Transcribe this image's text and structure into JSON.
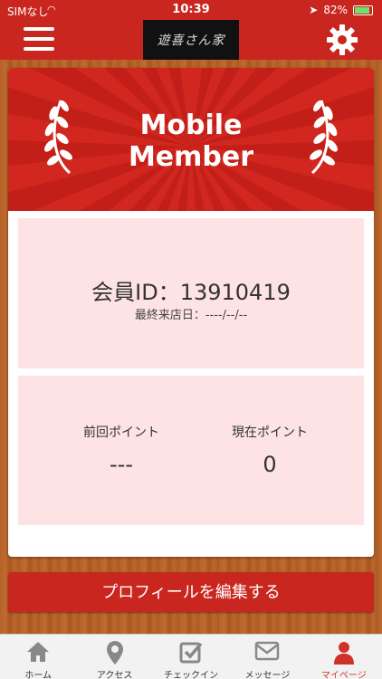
{
  "status_bar": {
    "carrier": "SIMなし",
    "time": "10:39",
    "battery": "82%"
  },
  "header": {
    "logo_text": "遊喜さん家"
  },
  "banner": {
    "title": "Mobile\nMember"
  },
  "member": {
    "id_label": "会員ID：13910419",
    "last_visit": "最終来店日：----/--/--"
  },
  "points": {
    "previous_label": "前回ポイント",
    "previous_value": "---",
    "current_label": "現在ポイント",
    "current_value": "0"
  },
  "edit_profile_label": "プロフィールを編集する",
  "tabs": [
    {
      "label": "ホーム",
      "icon": "home-icon"
    },
    {
      "label": "アクセス",
      "icon": "location-pin-icon"
    },
    {
      "label": "チェックイン",
      "icon": "checkin-icon"
    },
    {
      "label": "メッセージ",
      "icon": "mail-icon"
    },
    {
      "label": "マイページ",
      "icon": "person-icon",
      "active": true
    }
  ],
  "colors": {
    "brand_red": "#c9261f",
    "panel_pink": "#fde3e3",
    "active_tab": "#d0322a"
  }
}
